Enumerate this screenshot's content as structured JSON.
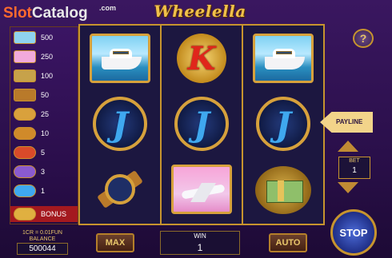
{
  "header": {
    "title": "Wheelella"
  },
  "watermark": {
    "slot": "Slot",
    "catalog": "Catalog",
    "com": ".com"
  },
  "paytable": {
    "rows": [
      {
        "icon": "yacht-icon",
        "value": "500"
      },
      {
        "icon": "jet-icon",
        "value": "250"
      },
      {
        "icon": "cash-icon",
        "value": "100"
      },
      {
        "icon": "watch-icon",
        "value": "50"
      },
      {
        "icon": "coin-icon",
        "value": "25"
      },
      {
        "icon": "a-coin-icon",
        "value": "10"
      },
      {
        "icon": "k-coin-icon",
        "value": "5"
      },
      {
        "icon": "q-coin-icon",
        "value": "3"
      },
      {
        "icon": "j-coin-icon",
        "value": "1"
      }
    ],
    "bonus": {
      "icon": "bonus-icon",
      "label": "BONUS"
    }
  },
  "reels": [
    [
      "yacht",
      "j",
      "watch"
    ],
    [
      "k",
      "j",
      "jet"
    ],
    [
      "yacht",
      "j",
      "cash"
    ]
  ],
  "payline": {
    "label": "PAYLINE"
  },
  "bet": {
    "label": "BET",
    "value": "1"
  },
  "info": {
    "cr": "1CR = 0.01FUN",
    "balance_label": "BALANCE",
    "balance": "500044"
  },
  "buttons": {
    "max": "MAX",
    "auto": "AUTO",
    "stop": "STOP",
    "help": "?"
  },
  "win": {
    "label": "WIN",
    "value": "1"
  },
  "colors": {
    "frame_gold": "#c7942e",
    "bonus_red": "#a4191f",
    "background": "#2a0f4a",
    "stop_blue": "#1f2e86"
  }
}
